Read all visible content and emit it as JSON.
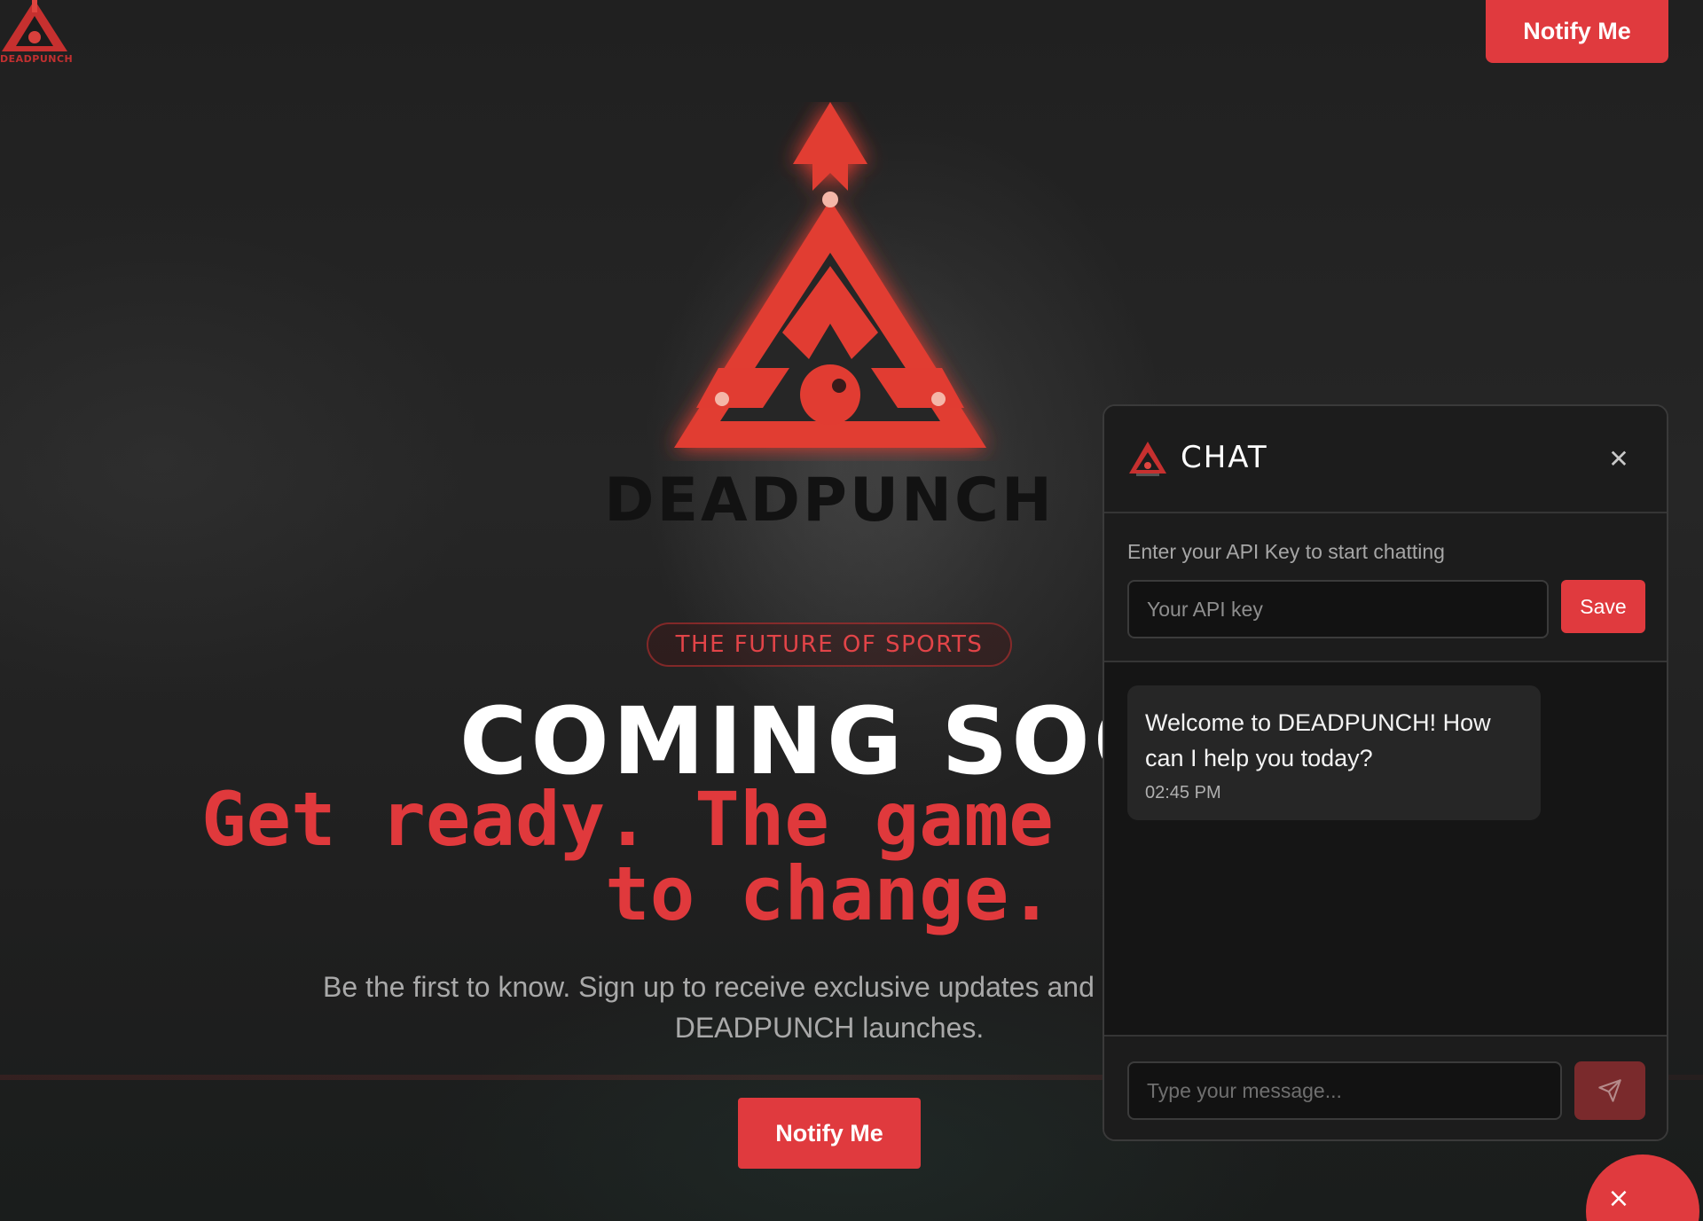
{
  "topbar": {
    "logo_text": "DEADPUNCH",
    "notify_label": "Notify Me"
  },
  "hero": {
    "brand": "DEADPUNCH",
    "tagline": "THE FUTURE OF SPORTS",
    "title": "COMING SOO",
    "headline": "Get ready. The game is about to change.",
    "subtitle": "Be the first to know. Sign up to receive exclusive updates and early access when DEADPUNCH launches.",
    "notify_label": "Notify Me"
  },
  "chat": {
    "title": "CHAT",
    "close_icon": "close-icon",
    "api_prompt": "Enter your API Key to start chatting",
    "api_placeholder": "Your API key",
    "save_label": "Save",
    "messages": [
      {
        "text": "Welcome to DEADPUNCH! How can I help you today?",
        "time": "02:45 PM"
      }
    ],
    "input_placeholder": "Type your message...",
    "send_icon": "send-icon"
  },
  "toggle": {
    "icon": "close-icon",
    "glyph": "×"
  },
  "colors": {
    "accent": "#e03a3e",
    "background": "#1b1b1b",
    "panel": "#1c1c1c"
  }
}
